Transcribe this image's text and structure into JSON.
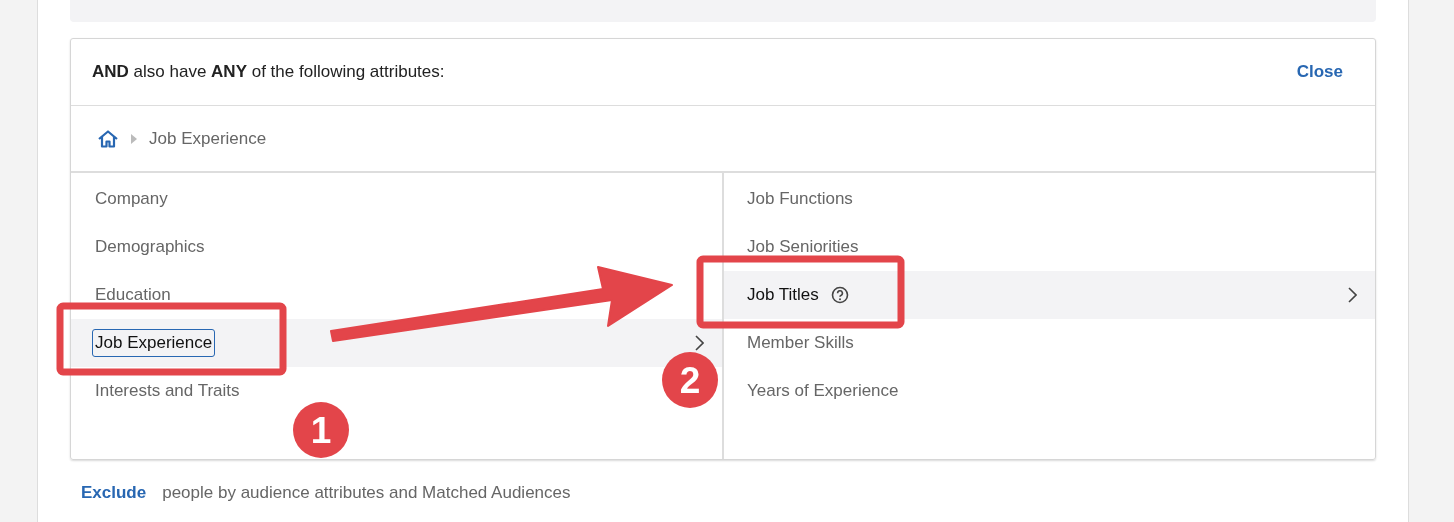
{
  "card": {
    "heading": "**AND** also have **ANY** of the following attributes:",
    "close": "Close",
    "breadcrumb": {
      "current": "Job Experience"
    },
    "left_items": [
      {
        "label": "Company",
        "selected": false,
        "focused": false
      },
      {
        "label": "Demographics",
        "selected": false,
        "focused": false
      },
      {
        "label": "Education",
        "selected": false,
        "focused": false
      },
      {
        "label": "Job Experience",
        "selected": true,
        "focused": true
      },
      {
        "label": "Interests and Traits",
        "selected": false,
        "focused": false
      }
    ],
    "right_items": [
      {
        "label": "Job Functions",
        "selected": false,
        "help": false
      },
      {
        "label": "Job Seniorities",
        "selected": false,
        "help": false
      },
      {
        "label": "Job Titles",
        "selected": true,
        "help": true
      },
      {
        "label": "Member Skills",
        "selected": false,
        "help": false
      },
      {
        "label": "Years of Experience",
        "selected": false,
        "help": false
      }
    ]
  },
  "footer": {
    "link": "Exclude",
    "text": "people by audience attributes and Matched Audiences"
  },
  "annotations": [
    {
      "label": "1"
    },
    {
      "label": "2"
    }
  ]
}
